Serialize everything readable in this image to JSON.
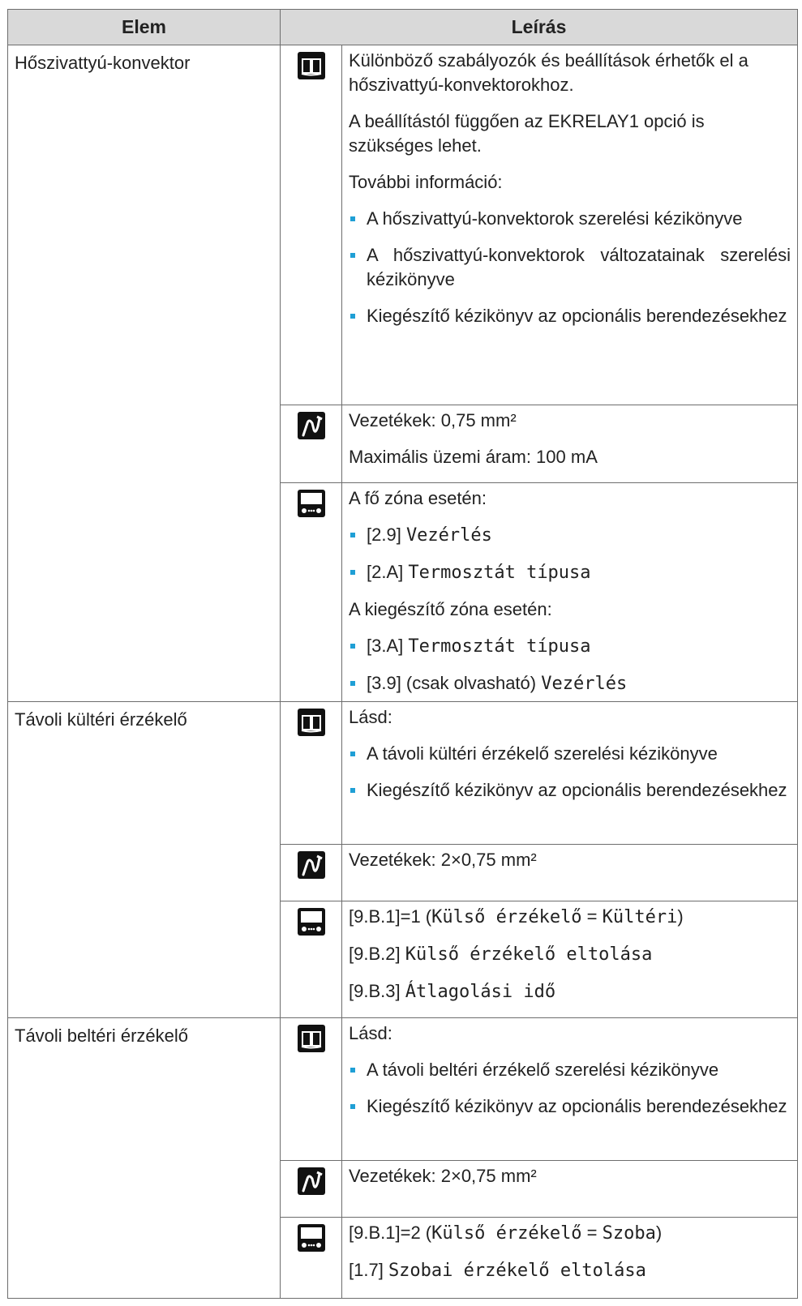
{
  "header": {
    "col1": "Elem",
    "col2": "Leírás"
  },
  "rows": [
    {
      "item": "Hőszivattyú-konvektor",
      "manual": {
        "p1": "Különböző szabályozók és beállítások érhetők el a hőszivattyú-konvektorokhoz.",
        "p2": "A beállítástól függően az EKRELAY1 opció is szükséges lehet.",
        "p3": "További információ:",
        "b1": "A hőszivattyú-konvektorok szerelési kézikönyve",
        "b2": "A hőszivattyú-konvektorok változatainak szerelési kézikönyve",
        "b3": "Kiegészítő kézikönyv az opcionális berendezésekhez"
      },
      "wiring": {
        "l1": "Vezetékek: 0,75 mm²",
        "l2": "Maximális üzemi áram: 100 mA"
      },
      "ui": {
        "h1": "A fő zóna esetén:",
        "b1_code": "[2.9]",
        "b1_name": "Vezérlés",
        "b2_code": "[2.A]",
        "b2_name": "Termosztát típusa",
        "h2": "A kiegészítő zóna esetén:",
        "b3_code": "[3.A]",
        "b3_name": "Termosztát típusa",
        "b4_code": "[3.9] (csak olvasható)",
        "b4_name": "Vezérlés"
      }
    },
    {
      "item": "Távoli kültéri érzékelő",
      "manual": {
        "p1": "Lásd:",
        "b1": "A távoli kültéri érzékelő szerelési kézikönyve",
        "b2": "Kiegészítő kézikönyv az opcionális berendezésekhez"
      },
      "wiring": {
        "l1": "Vezetékek: 2×0,75 mm²"
      },
      "ui": {
        "l1_code": "[9.B.1]=1 (",
        "l1_name": "Külső érzékelő",
        "l1_eq": " = ",
        "l1_val": "Kültéri",
        "l1_end": ")",
        "l2_code": "[9.B.2]",
        "l2_name": "Külső érzékelő eltolása",
        "l3_code": "[9.B.3]",
        "l3_name": "Átlagolási idő"
      }
    },
    {
      "item": "Távoli beltéri érzékelő",
      "manual": {
        "p1": "Lásd:",
        "b1": "A távoli beltéri érzékelő szerelési kézikönyve",
        "b2": "Kiegészítő kézikönyv az opcionális berendezésekhez"
      },
      "wiring": {
        "l1": "Vezetékek: 2×0,75 mm²"
      },
      "ui": {
        "l1_code": "[9.B.1]=2 (",
        "l1_name": "Külső érzékelő",
        "l1_eq": " = ",
        "l1_val": "Szoba",
        "l1_end": ")",
        "l2_code": "[1.7]",
        "l2_name": "Szobai érzékelő eltolása"
      }
    }
  ],
  "icons": {
    "manual": "book-icon",
    "wiring": "wiring-icon",
    "ui": "user-interface-icon"
  },
  "colors": {
    "bullet": "#1f9fd5",
    "header_bg": "#d9d9d9"
  }
}
